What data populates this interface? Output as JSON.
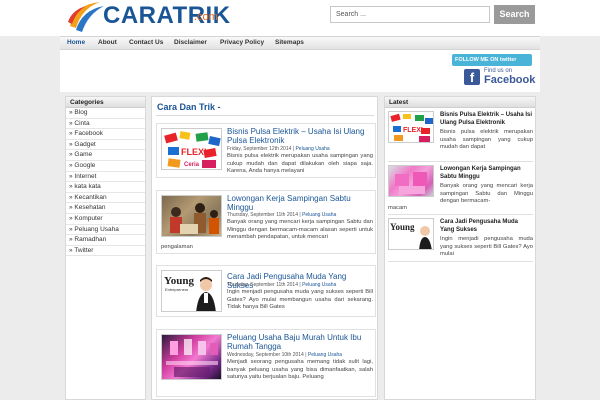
{
  "header": {
    "logo_text": "CARATRIK",
    "logo_suffix": ".com",
    "search_placeholder": "Search ...",
    "search_button": "Search"
  },
  "nav": {
    "items": [
      "Home",
      "About",
      "Contact Us",
      "Disclaimer",
      "Privacy Policy",
      "Sitemaps"
    ]
  },
  "social": {
    "twitter_label": "FOLLOW ME ON twitter",
    "facebook_find": "Find us on",
    "facebook_word": "Facebook"
  },
  "categories": {
    "title": "Categories",
    "items": [
      "» Blog",
      "» Cinta",
      "» Facebook",
      "» Gadget",
      "» Game",
      "» Google",
      "» Internet",
      "» kata kata",
      "» Kecantikan",
      "» Kesehatan",
      "» Komputer",
      "» Peluang Usaha",
      "» Ramadhan",
      "» Twitter"
    ]
  },
  "main": {
    "title": "Cara Dan Trik -",
    "posts": [
      {
        "title": "Bisnis Pulsa Elektrik – Usaha Isi Ulang Pulsa Elektronik",
        "date": "Friday, September 12th 2014",
        "sep": " | ",
        "category": "Peluang Usaha",
        "excerpt": "Bisnis pulsa elektrik merupakan usaha sampingan yang cukup mudah dan dapat dilakukan oleh siapa saja. Karena, Anda hanya melayani"
      },
      {
        "title": "Lowongan Kerja Sampingan Sabtu Minggu",
        "date": "Thursday, September 11th 2014",
        "sep": " | ",
        "category": "Peluang Usaha",
        "excerpt": "Banyak orang yang mencari kerja sampingan Sabtu dan Minggu dengan bermacam-macam alasan seperti untuk menambah pendapatan, untuk mencari",
        "excerpt_wrap": "pengalaman"
      },
      {
        "title": "Cara Jadi Pengusaha Muda Yang Sukses",
        "date": "Thursday, September 11th 2014",
        "sep": " | ",
        "category": "Peluang Usaha",
        "excerpt": "Ingin menjadi pengusaha muda yang sukses seperti Bill Gates? Ayo mulai membangun usaha dari sekarang. Tidak hanya Bill Gates"
      },
      {
        "title": "Peluang Usaha Baju Murah Untuk Ibu Rumah Tangga",
        "date": "Wednesday, September 10th 2014",
        "sep": " | ",
        "category": "Peluang Usaha",
        "excerpt": "Menjadi seorang pengusaha memang tidak sulit lagi, banyak peluang usaha yang bisa dimanfaatkan, salah satunya yaitu berjualan baju. Peluang"
      }
    ]
  },
  "latest": {
    "title": "Latest",
    "items": [
      {
        "title": "Bisnis Pulsa Elektrik – Usaha Isi Ulang Pulsa Elektronik",
        "excerpt": "Bisnis pulsa elektrik merupakan usaha sampingan yang cukup mudah dan dapat"
      },
      {
        "title": "Lowongan Kerja Sampingan Sabtu Minggu",
        "excerpt": "Banyak orang yang mencari kerja sampingan Sabtu dan Minggu dengan bermacam-",
        "excerpt_wrap": "macam"
      },
      {
        "title": "Cara Jadi Pengusaha Muda Yang Sukses",
        "excerpt": "Ingin menjadi pengusaha muda yang sukses seperti Bill Gates? Ayo mulai"
      }
    ]
  },
  "thumbs": {
    "young_word": "Young",
    "young_sub": "Entrepreneur",
    "flexi_word": "FLEXI",
    "ceria_word": "Ceria"
  }
}
